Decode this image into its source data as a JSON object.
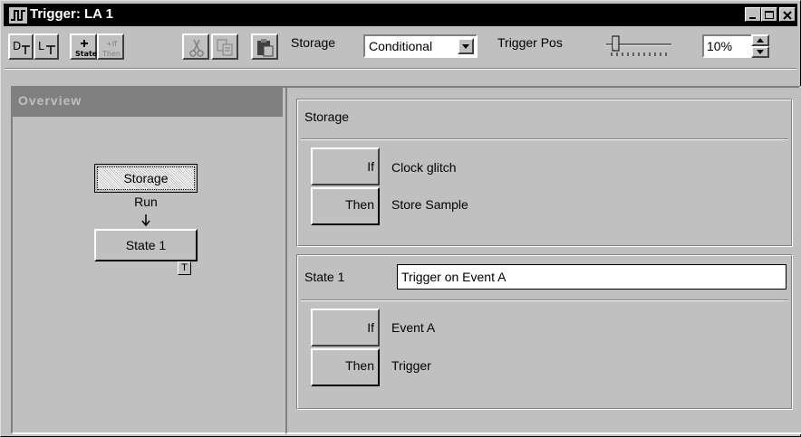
{
  "window": {
    "title": "Trigger: LA 1"
  },
  "toolbar": {
    "btn_d_label": "D",
    "btn_l_label": "L",
    "add_state_label": "State",
    "add_ifthen_label": "Then",
    "add_ifthen_plus": "+If",
    "storage_label": "Storage",
    "storage_value": "Conditional",
    "trigger_pos_label": "Trigger Pos",
    "trigger_pos_value": "10%"
  },
  "overview": {
    "header": "Overview",
    "storage_node": "Storage",
    "run_label": "Run",
    "state_node": "State 1",
    "trigger_marker": "T"
  },
  "storage_section": {
    "title": "Storage",
    "if_label": "If",
    "if_condition": "Clock glitch",
    "then_label": "Then",
    "then_action": "Store Sample"
  },
  "state_section": {
    "title": "State 1",
    "name_value": "Trigger on Event A",
    "if_label": "If",
    "if_condition": "Event A",
    "then_label": "Then",
    "then_action": "Trigger"
  }
}
